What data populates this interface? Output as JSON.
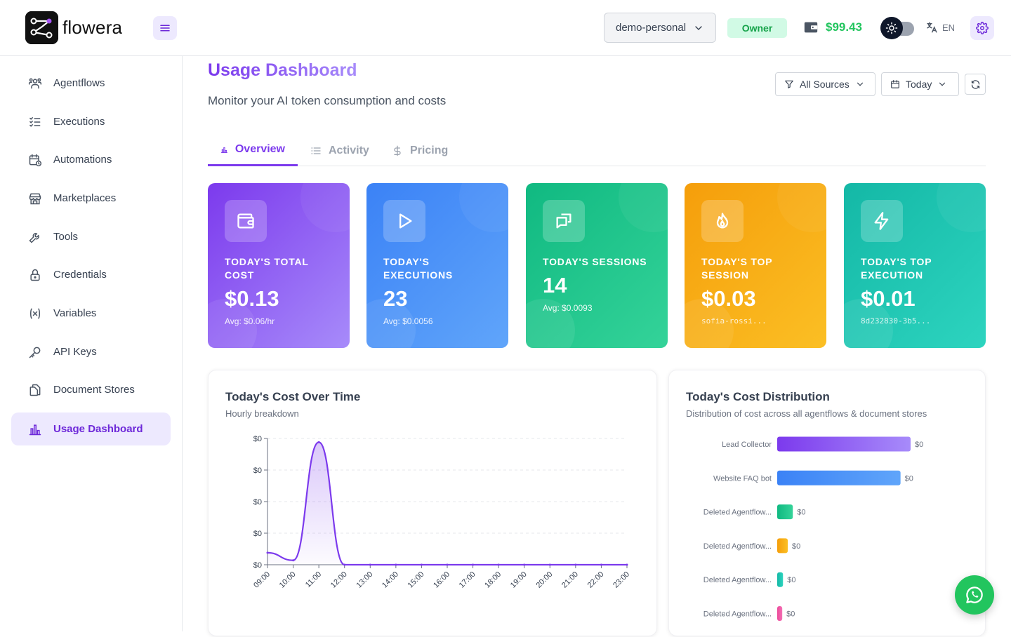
{
  "brand": {
    "name": "flowera"
  },
  "header": {
    "workspace": "demo-personal",
    "role_badge": "Owner",
    "wallet_balance": "$99.43",
    "language": "EN"
  },
  "sidebar": {
    "items": [
      {
        "label": "Agentflows",
        "icon": "agents-icon"
      },
      {
        "label": "Executions",
        "icon": "list-check-icon"
      },
      {
        "label": "Automations",
        "icon": "calendar-clock-icon"
      },
      {
        "label": "Marketplaces",
        "icon": "store-icon"
      },
      {
        "label": "Tools",
        "icon": "tool-icon"
      },
      {
        "label": "Credentials",
        "icon": "lock-icon"
      },
      {
        "label": "Variables",
        "icon": "variable-icon"
      },
      {
        "label": "API Keys",
        "icon": "key-icon"
      },
      {
        "label": "Document Stores",
        "icon": "files-icon"
      },
      {
        "label": "Usage Dashboard",
        "icon": "bar-chart-icon",
        "active": true
      }
    ]
  },
  "page": {
    "title": "Usage Dashboard",
    "subtitle": "Monitor your AI token consumption and costs",
    "filters": {
      "source": "All Sources",
      "range": "Today"
    },
    "tabs": [
      {
        "label": "Overview",
        "active": true
      },
      {
        "label": "Activity"
      },
      {
        "label": "Pricing"
      }
    ]
  },
  "stats": [
    {
      "label": "Today's Total Cost",
      "value": "$0.13",
      "sub": "Avg: $0.06/hr",
      "icon": "wallet-icon",
      "colors": [
        "#7c3aed",
        "#a78bfa"
      ]
    },
    {
      "label": "Today's Executions",
      "value": "23",
      "sub": "Avg: $0.0056",
      "icon": "play-icon",
      "colors": [
        "#3b82f6",
        "#60a5fa"
      ]
    },
    {
      "label": "Today's Sessions",
      "value": "14",
      "sub": "Avg: $0.0093",
      "icon": "chat-icon",
      "colors": [
        "#10b981",
        "#34d399"
      ]
    },
    {
      "label": "Today's Top Session",
      "value": "$0.03",
      "sub": "sofia-rossi...",
      "icon": "flame-icon",
      "colors": [
        "#f59e0b",
        "#fbbf24"
      ]
    },
    {
      "label": "Today's Top Execution",
      "value": "$0.01",
      "sub": "8d232830-3b5...",
      "icon": "bolt-icon",
      "colors": [
        "#14b8a6",
        "#2dd4bf"
      ]
    }
  ],
  "cost_over_time": {
    "title": "Today's Cost Over Time",
    "subtitle": "Hourly breakdown",
    "line_color": "#7c3aed",
    "chart_data": {
      "type": "area",
      "x": [
        "09:00",
        "10:00",
        "11:00",
        "12:00",
        "13:00",
        "14:00",
        "15:00",
        "16:00",
        "17:00",
        "18:00",
        "19:00",
        "20:00",
        "21:00",
        "22:00",
        "23:00"
      ],
      "y": [
        0.0095,
        0.0035,
        0.097,
        0.0,
        0.0,
        0.0,
        0.0,
        0.0,
        0.0,
        0.0,
        0.0,
        0.0,
        0.0,
        0.0,
        0.0
      ],
      "y_tick_labels": [
        "$0",
        "$0",
        "$0",
        "$0",
        "$0"
      ],
      "ylim": [
        0,
        0.1
      ],
      "grid": true
    }
  },
  "cost_distribution": {
    "title": "Today's Cost Distribution",
    "subtitle": "Distribution of cost across all agentflows & document stores",
    "chart_data": {
      "type": "bar",
      "orientation": "horizontal",
      "categories": [
        "Lead Collector",
        "Website FAQ bot",
        "Deleted Agentflow...",
        "Deleted Agentflow...",
        "Deleted Agentflow...",
        "Deleted Agentflow..."
      ],
      "values": [
        0.053,
        0.049,
        0.0062,
        0.0042,
        0.0023,
        0.002
      ],
      "value_labels": [
        "$0",
        "$0",
        "$0",
        "$0",
        "$0",
        "$0"
      ],
      "colors": [
        [
          "#7c3aed",
          "#a78bfa"
        ],
        [
          "#3b82f6",
          "#60a5fa"
        ],
        [
          "#10b981",
          "#34d399"
        ],
        [
          "#f59e0b",
          "#fbbf24"
        ],
        [
          "#14b8a6",
          "#2dd4bf"
        ],
        [
          "#ec4899",
          "#f472b6"
        ]
      ]
    }
  }
}
